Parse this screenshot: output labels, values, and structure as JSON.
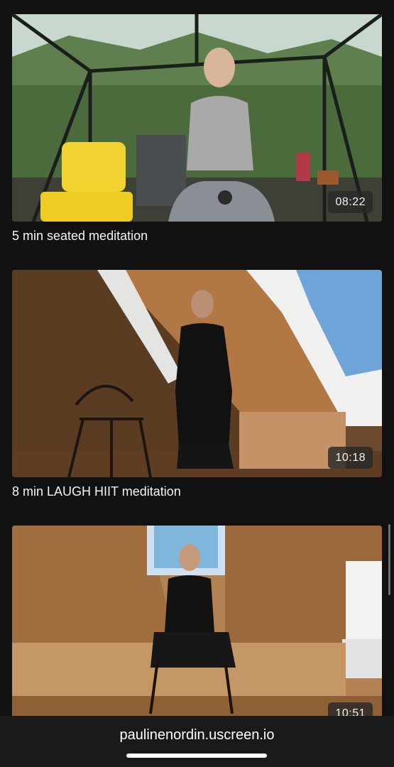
{
  "videos": [
    {
      "title": "5 min seated meditation",
      "duration": "08:22",
      "thumbnail": "woman-seated-meditation-greenhouse"
    },
    {
      "title": "8 min LAUGH HIIT meditation",
      "duration": "10:18",
      "thumbnail": "woman-laughing-attic-room"
    },
    {
      "title": "",
      "duration": "10:51",
      "thumbnail": "woman-seated-chair-attic-room"
    }
  ],
  "browser": {
    "url": "paulinenordin.uscreen.io"
  },
  "colors": {
    "background": "#111112",
    "bottom_bar": "#1a1a1b",
    "duration_badge": "#282828"
  }
}
